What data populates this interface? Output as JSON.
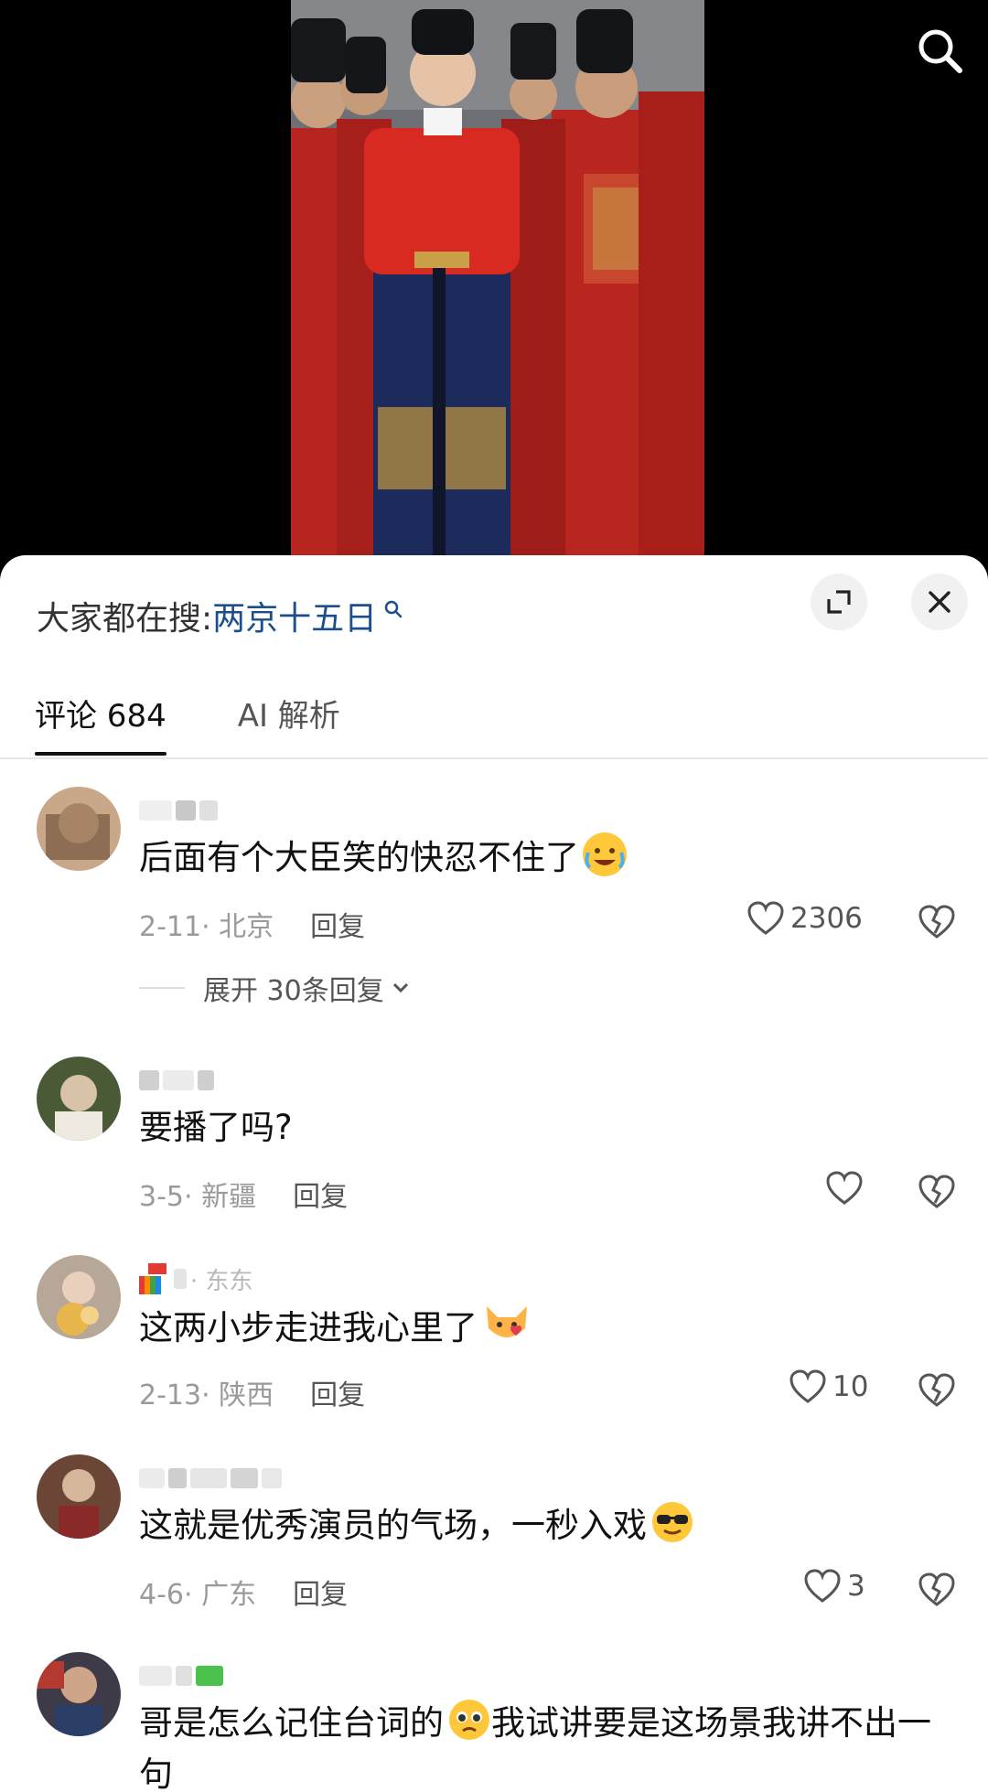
{
  "header": {
    "search_icon": "search-icon"
  },
  "sheet": {
    "hot_search_prefix": "大家都在搜:",
    "hot_search_keyword": "两京十五日",
    "expand_icon": "expand-icon",
    "close_icon": "close-icon",
    "tabs": [
      {
        "label": "评论 684",
        "active": true
      },
      {
        "label": "AI 解析",
        "active": false
      }
    ]
  },
  "comments": [
    {
      "text": "后面有个大臣笑的快忍不住了",
      "date_location": "2-11· 北京",
      "reply_label": "回复",
      "likes": "2306",
      "emoji": "laugh-cry-emoji",
      "expand_label": "展开 30条回复"
    },
    {
      "text": "要播了吗?",
      "date_location": "3-5· 新疆",
      "reply_label": "回复",
      "likes": ""
    },
    {
      "text": "这两小步走进我心里了",
      "date_location": "2-13· 陕西",
      "reply_label": "回复",
      "likes": "10",
      "emoji": "cat-heart-emoji",
      "username_partial": "· 东东"
    },
    {
      "text": "这就是优秀演员的气场，一秒入戏",
      "date_location": "4-6· 广东",
      "reply_label": "回复",
      "likes": "3",
      "emoji": "sunglasses-emoji"
    },
    {
      "text_part1": "哥是怎么记住台词的",
      "text_part2": "我试讲要是这场景我讲不出一句",
      "emoji": "pleading-emoji"
    }
  ],
  "colors": {
    "keyword": "#1c4e8e",
    "meta": "#9a9a9a",
    "text": "#111111"
  }
}
